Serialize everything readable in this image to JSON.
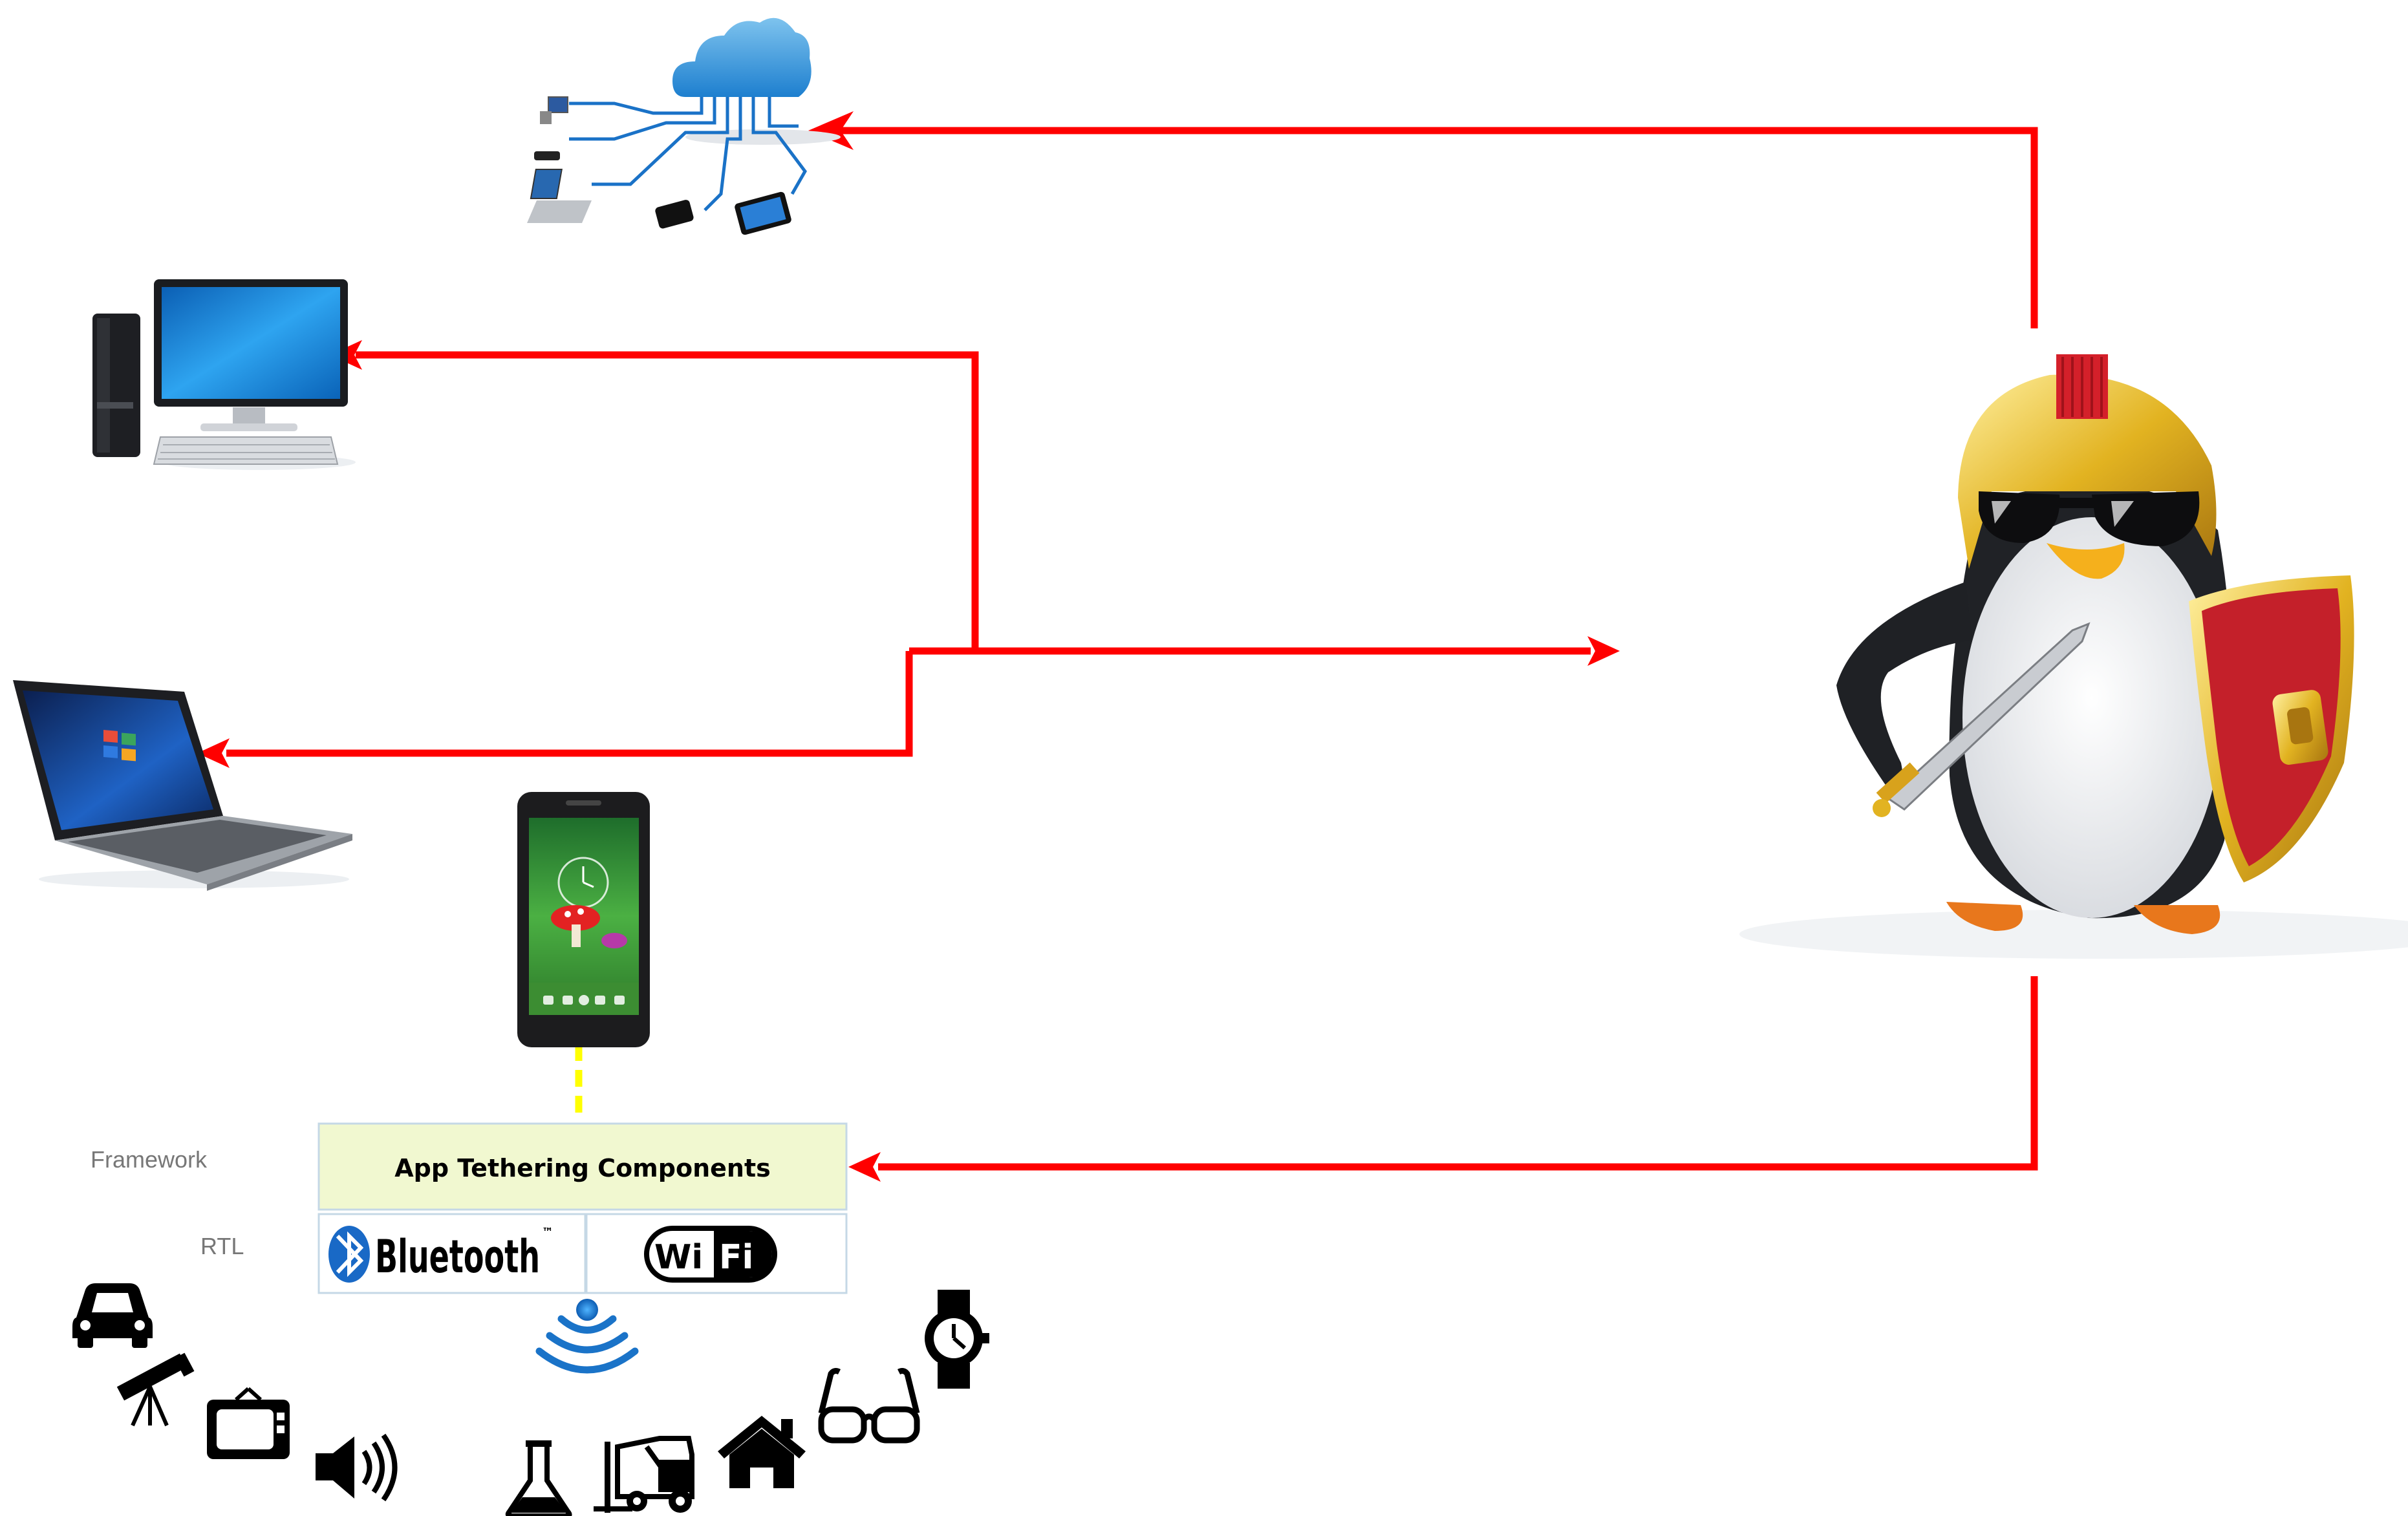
{
  "tethering_box": {
    "title": "App Tethering Components"
  },
  "labels": {
    "framework": "Framework",
    "rtl": "RTL"
  },
  "protocols": {
    "bluetooth": "Bluetooth",
    "bluetooth_tm": "™",
    "wifi_left": "Wi",
    "wifi_right": "Fi"
  },
  "colors": {
    "arrow": "#ff0000",
    "tether_link": "#ffff00",
    "box_fill": "#f1f8d0",
    "box_border": "#c5d8e6",
    "signal_blue": "#1a73c8"
  },
  "icons": [
    "cloud-network-icon",
    "desktop-computer-icon",
    "laptop-icon",
    "smartphone-icon",
    "penguin-gladiator-mascot",
    "bluetooth-icon",
    "wifi-logo-icon",
    "wireless-signal-icon",
    "car-icon",
    "telescope-icon",
    "tv-icon",
    "speaker-icon",
    "flask-icon",
    "forklift-icon",
    "house-icon",
    "glasses-icon",
    "smartwatch-icon"
  ]
}
